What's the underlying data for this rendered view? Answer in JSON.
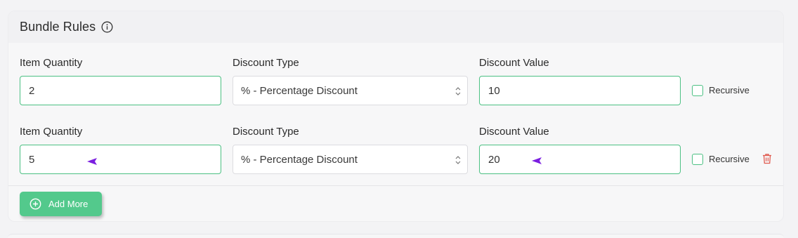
{
  "card": {
    "title": "Bundle Rules",
    "info_icon": "info-circle-icon"
  },
  "rules": [
    {
      "quantity_label": "Item Quantity",
      "quantity_value": "2",
      "type_label": "Discount Type",
      "type_value": "% - Percentage Discount",
      "value_label": "Discount Value",
      "value_value": "10",
      "recursive_label": "Recursive",
      "recursive_checked": false
    },
    {
      "quantity_label": "Item Quantity",
      "quantity_value": "5",
      "type_label": "Discount Type",
      "type_value": "% - Percentage Discount",
      "value_label": "Discount Value",
      "value_value": "20",
      "recursive_label": "Recursive",
      "recursive_checked": false,
      "delete_icon": "trash-icon"
    }
  ],
  "add_more": {
    "label": "Add More",
    "icon": "plus-circle-icon"
  },
  "colors": {
    "accent": "#4cc083",
    "button": "#53c98c",
    "cursor_marker": "#7b1fe0",
    "delete": "#e05a4f"
  }
}
